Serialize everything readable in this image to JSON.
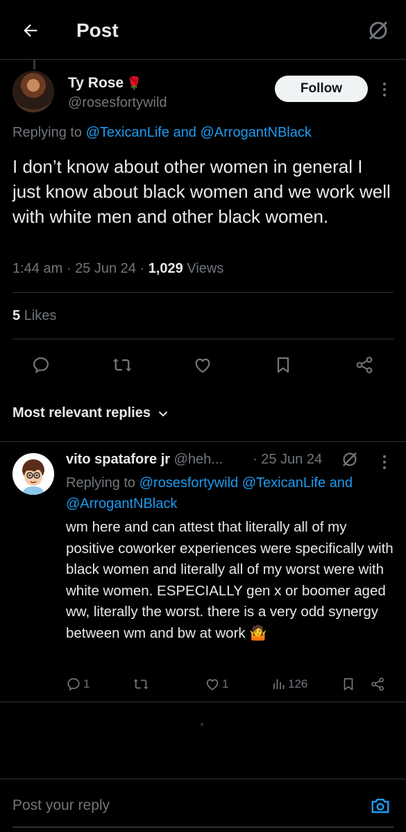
{
  "header": {
    "title": "Post"
  },
  "tweet": {
    "author_name": "Ty Rose",
    "author_emoji": "🌹",
    "author_handle": "@rosesfortywild",
    "follow_label": "Follow",
    "replying_prefix": "Replying to",
    "replying_to_1": "@TexicanLife",
    "replying_and": "and",
    "replying_to_2": "@ArrogantNBlack",
    "text": "I don’t know about other women in general I just know about black women and we work well with white men and other black women.",
    "time": "1:44 am",
    "sep": "·",
    "date": "25 Jun 24",
    "views_count": "1,029",
    "views_label": "Views",
    "likes_count": "5",
    "likes_label": "Likes"
  },
  "sort": {
    "label": "Most relevant replies"
  },
  "reply": {
    "name": "vito spatafore jr",
    "handle": "@heh...",
    "date": "· 25 Jun 24",
    "replying_prefix": "Replying to",
    "replying_to_1": "@rosesfortywild",
    "replying_to_2": "@TexicanLife",
    "replying_and": "and",
    "replying_to_3": "@ArrogantNBlack",
    "text": "wm here and can attest that literally all of my positive coworker experiences were specifically with black women and literally all of my worst were with white women. ESPECIALLY gen x or boomer aged ww, literally the worst. there is a very odd synergy between wm and bw at work 🤷",
    "reply_count": "1",
    "like_count": "1",
    "view_count": "126"
  },
  "compose": {
    "placeholder": "Post your reply"
  },
  "colors": {
    "background": "#000000",
    "text": "#e7e9ea",
    "muted": "#71767b",
    "link": "#1d9bf0",
    "divider": "#2f3336"
  },
  "icons": [
    "back-arrow-icon",
    "grok-icon",
    "rose-icon",
    "more-icon",
    "reply-icon",
    "repost-icon",
    "like-icon",
    "bookmark-icon",
    "share-icon",
    "chevron-down-icon",
    "views-icon",
    "camera-icon"
  ]
}
